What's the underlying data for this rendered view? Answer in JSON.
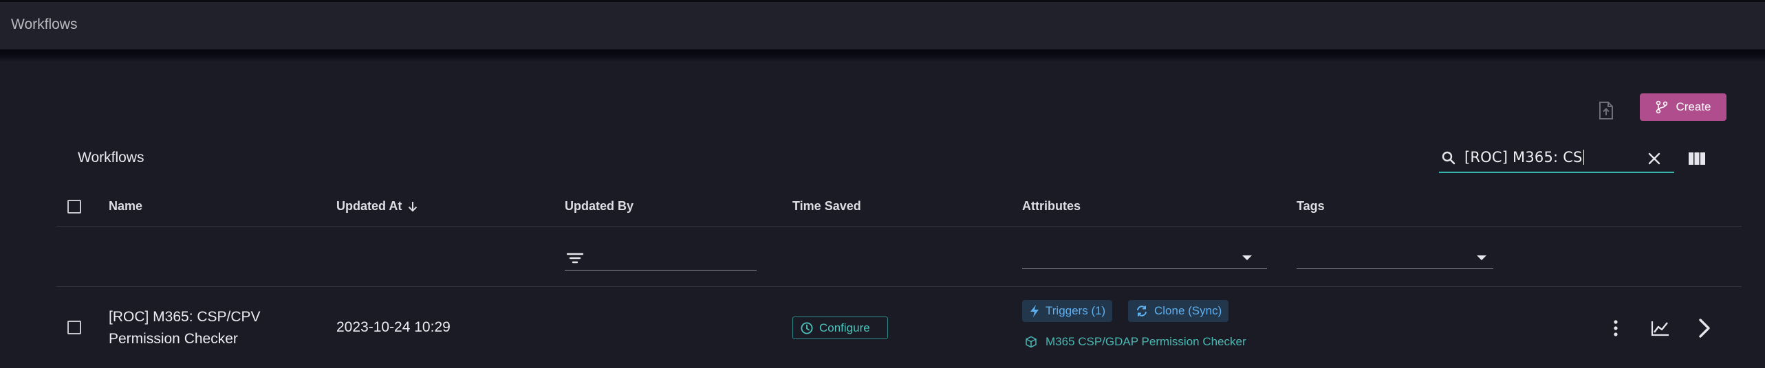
{
  "header": {
    "title": "Workflows"
  },
  "toolbar": {
    "create_label": "Create",
    "upload_icon": "file-upload-icon",
    "create_icon": "git-branch-icon"
  },
  "table": {
    "title": "Workflows",
    "search": {
      "value": "[ROC] M365: CS"
    },
    "columns": [
      "Name",
      "Updated At",
      "Updated By",
      "Time Saved",
      "Attributes",
      "Tags"
    ],
    "sort": {
      "column": "Updated At",
      "direction": "desc"
    },
    "rows": [
      {
        "name_line1": "[ROC] M365: CSP/CPV",
        "name_line2": "Permission Checker",
        "updated_at": "2023-10-24 10:29",
        "updated_by": "",
        "time_saved": "Configure",
        "attributes": {
          "triggers": "Triggers (1)",
          "clone": "Clone (Sync)",
          "linked_workflow": "M365 CSP/GDAP Permission Checker"
        },
        "tags": []
      }
    ]
  },
  "colors": {
    "accent": "#b04e8d",
    "teal": "#35b5ac",
    "chip_bg": "#22364c",
    "chip_text": "#5fb0ef"
  }
}
